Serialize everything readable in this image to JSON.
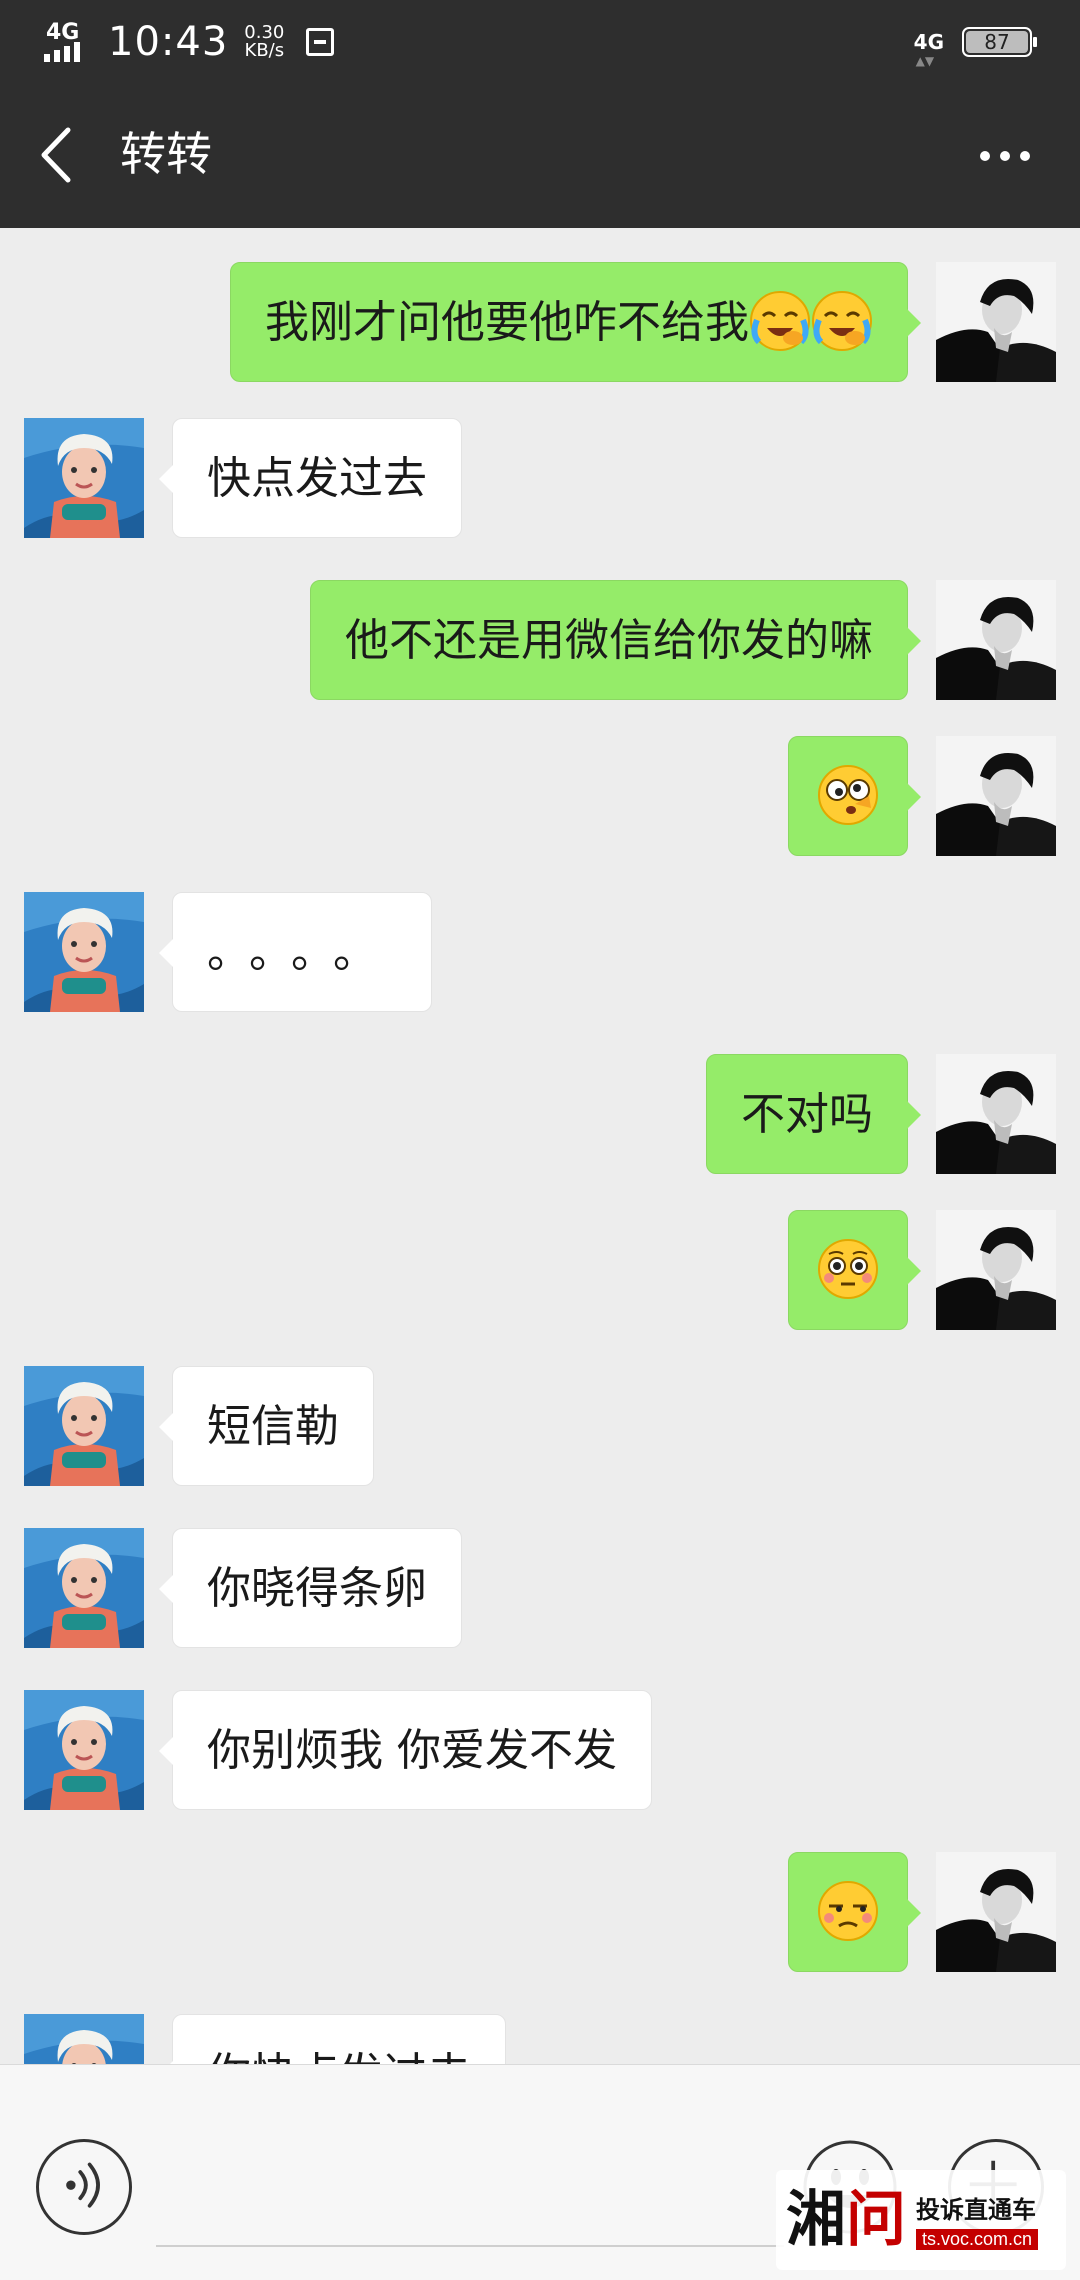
{
  "status_bar": {
    "network": "4G",
    "time": "10:43",
    "speed_value": "0.30",
    "speed_unit": "KB/s",
    "right_network": "4G",
    "battery": "87"
  },
  "header": {
    "title": "转转"
  },
  "messages": [
    {
      "side": "right",
      "text": "我刚才问他要他咋不给我",
      "emojis": [
        "sob-laugh",
        "sob-laugh"
      ]
    },
    {
      "side": "left",
      "text": "快点发过去"
    },
    {
      "side": "right",
      "text": "他不还是用微信给你发的嘛"
    },
    {
      "side": "right",
      "text": "",
      "emojis": [
        "dizzy-face"
      ]
    },
    {
      "side": "left",
      "text": "。。。。"
    },
    {
      "side": "right",
      "text": "不对吗"
    },
    {
      "side": "right",
      "text": "",
      "emojis": [
        "flushed-face"
      ]
    },
    {
      "side": "left",
      "text": "短信勒"
    },
    {
      "side": "left",
      "text": "你晓得条卵"
    },
    {
      "side": "left",
      "text": "你别烦我  你爱发不发"
    },
    {
      "side": "right",
      "text": "",
      "emojis": [
        "unamused-face"
      ]
    },
    {
      "side": "left",
      "text": "你快点发过去"
    }
  ],
  "input_bar": {
    "voice_icon": "voice-icon",
    "emoji_icon": "emoji-icon",
    "plus_icon": "plus-icon",
    "placeholder": ""
  },
  "watermark": {
    "logo_part1": "湘",
    "logo_part2": "问",
    "title": "投诉直通车",
    "url": "ts.voc.com.cn"
  },
  "colors": {
    "header_bg": "#2e2e2e",
    "chat_bg": "#ededed",
    "sent_bubble": "#95ec69",
    "received_bubble": "#ffffff"
  }
}
